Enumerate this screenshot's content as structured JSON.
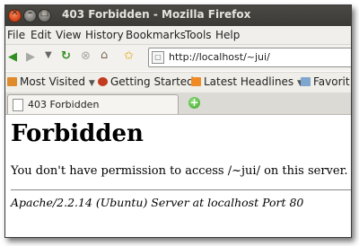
{
  "window": {
    "title": "403 Forbidden - Mozilla Firefox"
  },
  "menubar": {
    "items": [
      {
        "label": "File"
      },
      {
        "label": "Edit"
      },
      {
        "label": "View"
      },
      {
        "label": "History"
      },
      {
        "label": "Bookmarks"
      },
      {
        "label": "Tools"
      },
      {
        "label": "Help"
      }
    ]
  },
  "navbar": {
    "url": "http://localhost/~jui/"
  },
  "bookmarks": {
    "items": [
      {
        "label": "Most Visited",
        "icon": "most-visited-icon"
      },
      {
        "label": "Getting Started",
        "icon": "firefox-icon"
      },
      {
        "label": "Latest Headlines",
        "icon": "rss-icon"
      },
      {
        "label": "Favorit",
        "icon": "folder-icon"
      }
    ]
  },
  "tabs": [
    {
      "label": "403 Forbidden"
    }
  ],
  "page": {
    "heading": "Forbidden",
    "message": "You don't have permission to access /~jui/ on this server.",
    "address": "Apache/2.2.14 (Ubuntu) Server at localhost Port 80"
  }
}
